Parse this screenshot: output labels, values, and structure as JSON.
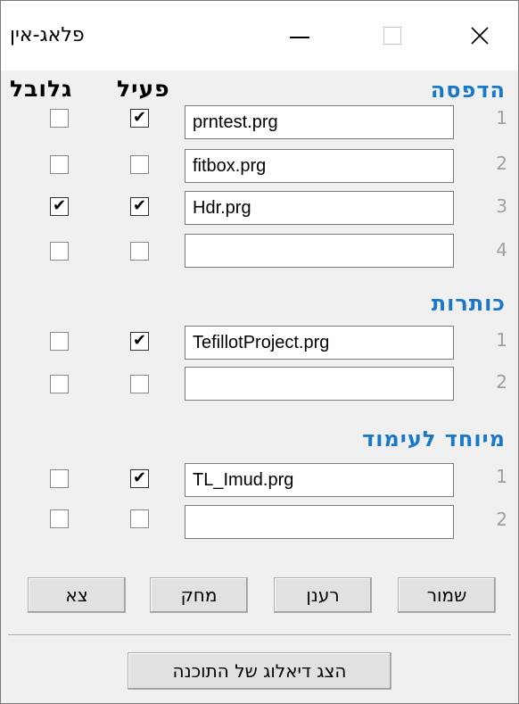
{
  "window": {
    "title": "פלאג-אין",
    "close_glyph": "✕"
  },
  "headers": {
    "global": "גלובל",
    "active": "פעיל"
  },
  "sections": [
    {
      "title": "הדפסה",
      "rows": [
        {
          "num": "1",
          "value": "prntest.prg",
          "active": true,
          "global": false
        },
        {
          "num": "2",
          "value": "fitbox.prg",
          "active": false,
          "global": false
        },
        {
          "num": "3",
          "value": "Hdr.prg",
          "active": true,
          "global": true
        },
        {
          "num": "4",
          "value": "",
          "active": false,
          "global": false
        }
      ]
    },
    {
      "title": "כותרות",
      "rows": [
        {
          "num": "1",
          "value": "TefillotProject.prg",
          "active": true,
          "global": false
        },
        {
          "num": "2",
          "value": "",
          "active": false,
          "global": false
        }
      ]
    },
    {
      "title": "מיוחד לעימוד",
      "rows": [
        {
          "num": "1",
          "value": "TL_Imud.prg",
          "active": true,
          "global": false
        },
        {
          "num": "2",
          "value": "",
          "active": false,
          "global": false
        }
      ]
    }
  ],
  "buttons": {
    "exit": "צא",
    "delete": "מחק",
    "refresh": "רענן",
    "save": "שמור",
    "show_dialog": "הצג דיאלוג של התוכנה"
  },
  "check_glyph": "✔"
}
